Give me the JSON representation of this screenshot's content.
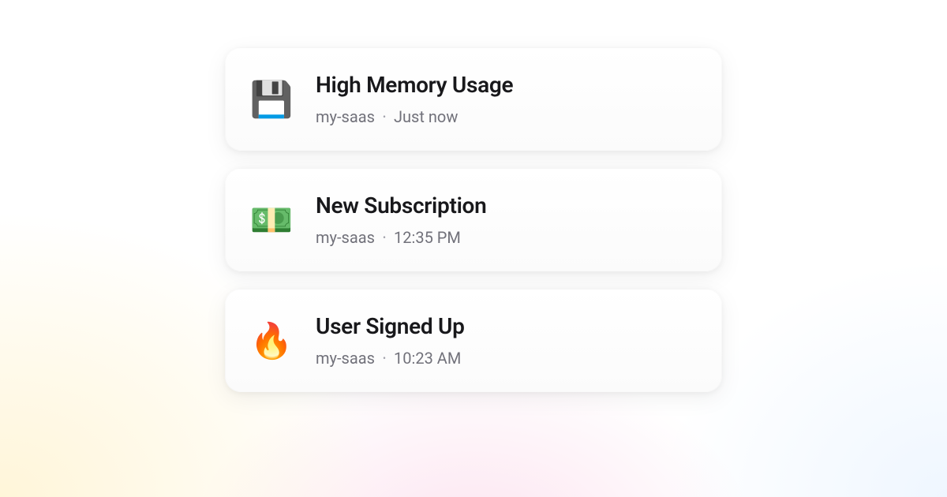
{
  "notifications": [
    {
      "icon": "💾",
      "icon_name": "floppy-disk-icon",
      "title": "High Memory Usage",
      "project": "my-saas",
      "time": "Just now"
    },
    {
      "icon": "💵",
      "icon_name": "money-icon",
      "title": "New Subscription",
      "project": "my-saas",
      "time": "12:35 PM"
    },
    {
      "icon": "🔥",
      "icon_name": "fire-icon",
      "title": "User Signed Up",
      "project": "my-saas",
      "time": "10:23 AM"
    }
  ],
  "separator": "•"
}
